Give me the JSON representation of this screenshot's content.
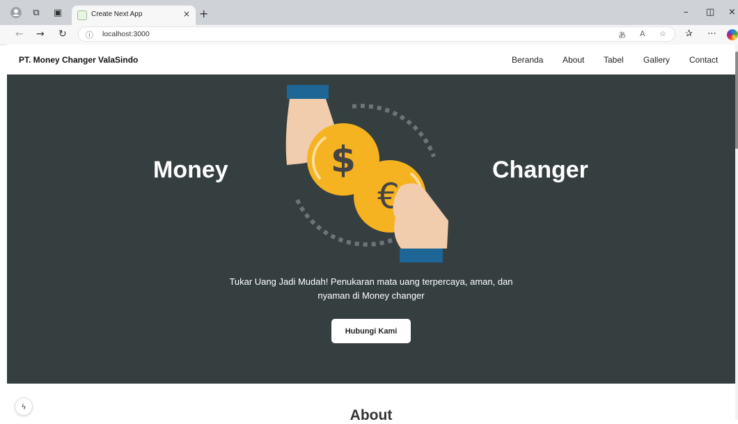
{
  "browser": {
    "tab_title": "Create Next App",
    "url": "localhost:3000",
    "icons": [
      "profile-icon",
      "workspaces-icon",
      "tab-actions-icon",
      "close-tab-icon",
      "new-tab-icon",
      "minimize-icon",
      "restore-icon",
      "close-window-icon",
      "back-icon",
      "forward-icon",
      "refresh-icon",
      "site-info-icon",
      "translate-icon",
      "read-aloud-icon",
      "favorite-icon",
      "favorites-icon",
      "more-icon",
      "copilot-icon"
    ]
  },
  "site": {
    "brand": "PT. Money Changer ValaSindo",
    "nav": [
      "Beranda",
      "About",
      "Tabel",
      "Gallery",
      "Contact"
    ]
  },
  "hero": {
    "word_left": "Money",
    "word_right": "Changer",
    "description": "Tukar Uang Jadi Mudah! Penukaran mata uang terpercaya, aman, dan nyaman di Money changer",
    "cta": "Hubungi Kami",
    "colors": {
      "background": "#363f40",
      "coin": "#f6b321",
      "coin_dark": "#e59a12",
      "sleeve": "#1d6695",
      "skin": "#f1ccad",
      "symbol": "#444444"
    }
  },
  "about": {
    "title": "About"
  }
}
